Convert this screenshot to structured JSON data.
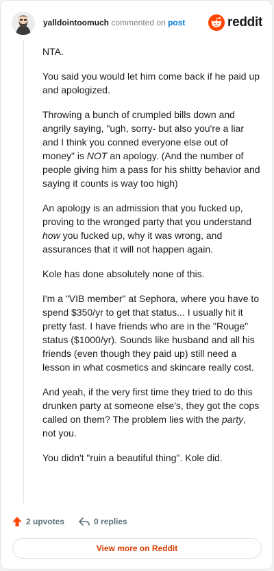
{
  "header": {
    "username": "yalldointoomuch",
    "commented_on": "commented on",
    "post_link": "post",
    "brand": "reddit"
  },
  "comment": {
    "p1": "NTA.",
    "p2": "You said you would let him come back if he paid up and apologized.",
    "p3_a": "Throwing a bunch of crumpled bills down and angrily saying, \"ugh, sorry- but also you're a liar and I think you conned everyone else out of money\" is ",
    "p3_em": "NOT",
    "p3_b": " an apology. (And the number of people giving him a pass for his shitty behavior and saying it counts is way too high)",
    "p4_a": "An apology is an admission that you fucked up, proving to the wronged party that you understand ",
    "p4_em": "how",
    "p4_b": " you fucked up, why it was wrong, and assurances that it will not happen again.",
    "p5": "Kole has done absolutely none of this.",
    "p6": "I'm a \"VIB member\" at Sephora, where you have to spend $350/yr to get that status... I usually hit it pretty fast. I have friends who are in the \"Rouge\" status ($1000/yr). Sounds like husband and all his friends (even though they paid up) still need a lesson in what cosmetics and skincare really cost.",
    "p7_a": "And yeah, if the very first time they tried to do this drunken party at someone else's, they got the cops called on them? The problem lies with the ",
    "p7_em": "party",
    "p7_b": ", not you.",
    "p8": "You didn't \"ruin a beautiful thing\". Kole did."
  },
  "footer": {
    "upvotes": "2 upvotes",
    "replies": "0 replies",
    "view_more": "View more on Reddit"
  },
  "colors": {
    "reddit_orange": "#ff4500",
    "link_blue": "#0079d3",
    "view_more_text": "#d93a00"
  },
  "icons": {
    "avatar": "avatar",
    "logo": "reddit-logo-icon",
    "upvote": "upvote-arrow-icon",
    "reply": "reply-arrow-icon"
  }
}
